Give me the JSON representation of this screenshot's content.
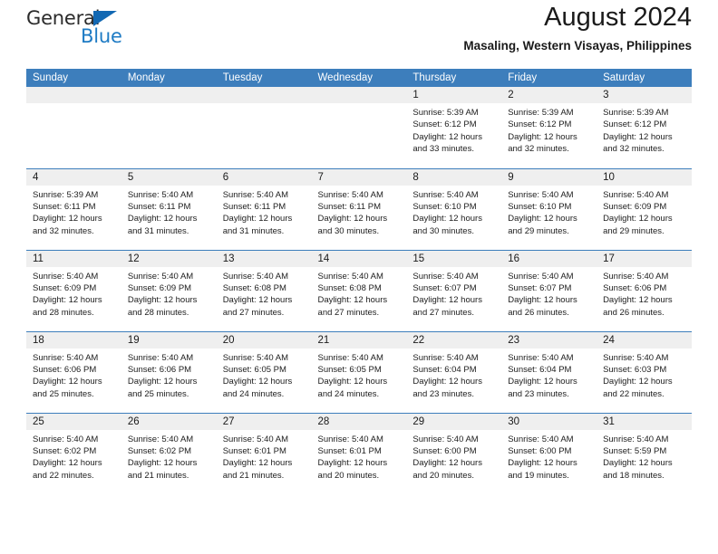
{
  "brand": {
    "name_part1": "General",
    "name_part2": "Blue",
    "triangle_color": "#1268b3",
    "blue_text_color": "#1e7bc4"
  },
  "header": {
    "title": "August 2024",
    "subtitle": "Masaling, Western Visayas, Philippines"
  },
  "theme": {
    "header_blue": "#3d7ebc",
    "daynum_gray": "#efefef",
    "cell_white": "#ffffff",
    "text_dark": "#1a1a1a"
  },
  "calendar": {
    "weekday_headers": [
      "Sunday",
      "Monday",
      "Tuesday",
      "Wednesday",
      "Thursday",
      "Friday",
      "Saturday"
    ],
    "labels": {
      "sunrise": "Sunrise:",
      "sunset": "Sunset:",
      "daylight": "Daylight:"
    },
    "weeks": [
      [
        {
          "day": "",
          "blank": true
        },
        {
          "day": "",
          "blank": true
        },
        {
          "day": "",
          "blank": true
        },
        {
          "day": "",
          "blank": true
        },
        {
          "day": "1",
          "sunrise": "Sunrise: 5:39 AM",
          "sunset": "Sunset: 6:12 PM",
          "daylight_line1": "Daylight: 12 hours",
          "daylight_line2": "and 33 minutes."
        },
        {
          "day": "2",
          "sunrise": "Sunrise: 5:39 AM",
          "sunset": "Sunset: 6:12 PM",
          "daylight_line1": "Daylight: 12 hours",
          "daylight_line2": "and 32 minutes."
        },
        {
          "day": "3",
          "sunrise": "Sunrise: 5:39 AM",
          "sunset": "Sunset: 6:12 PM",
          "daylight_line1": "Daylight: 12 hours",
          "daylight_line2": "and 32 minutes."
        }
      ],
      [
        {
          "day": "4",
          "sunrise": "Sunrise: 5:39 AM",
          "sunset": "Sunset: 6:11 PM",
          "daylight_line1": "Daylight: 12 hours",
          "daylight_line2": "and 32 minutes."
        },
        {
          "day": "5",
          "sunrise": "Sunrise: 5:40 AM",
          "sunset": "Sunset: 6:11 PM",
          "daylight_line1": "Daylight: 12 hours",
          "daylight_line2": "and 31 minutes."
        },
        {
          "day": "6",
          "sunrise": "Sunrise: 5:40 AM",
          "sunset": "Sunset: 6:11 PM",
          "daylight_line1": "Daylight: 12 hours",
          "daylight_line2": "and 31 minutes."
        },
        {
          "day": "7",
          "sunrise": "Sunrise: 5:40 AM",
          "sunset": "Sunset: 6:11 PM",
          "daylight_line1": "Daylight: 12 hours",
          "daylight_line2": "and 30 minutes."
        },
        {
          "day": "8",
          "sunrise": "Sunrise: 5:40 AM",
          "sunset": "Sunset: 6:10 PM",
          "daylight_line1": "Daylight: 12 hours",
          "daylight_line2": "and 30 minutes."
        },
        {
          "day": "9",
          "sunrise": "Sunrise: 5:40 AM",
          "sunset": "Sunset: 6:10 PM",
          "daylight_line1": "Daylight: 12 hours",
          "daylight_line2": "and 29 minutes."
        },
        {
          "day": "10",
          "sunrise": "Sunrise: 5:40 AM",
          "sunset": "Sunset: 6:09 PM",
          "daylight_line1": "Daylight: 12 hours",
          "daylight_line2": "and 29 minutes."
        }
      ],
      [
        {
          "day": "11",
          "sunrise": "Sunrise: 5:40 AM",
          "sunset": "Sunset: 6:09 PM",
          "daylight_line1": "Daylight: 12 hours",
          "daylight_line2": "and 28 minutes."
        },
        {
          "day": "12",
          "sunrise": "Sunrise: 5:40 AM",
          "sunset": "Sunset: 6:09 PM",
          "daylight_line1": "Daylight: 12 hours",
          "daylight_line2": "and 28 minutes."
        },
        {
          "day": "13",
          "sunrise": "Sunrise: 5:40 AM",
          "sunset": "Sunset: 6:08 PM",
          "daylight_line1": "Daylight: 12 hours",
          "daylight_line2": "and 27 minutes."
        },
        {
          "day": "14",
          "sunrise": "Sunrise: 5:40 AM",
          "sunset": "Sunset: 6:08 PM",
          "daylight_line1": "Daylight: 12 hours",
          "daylight_line2": "and 27 minutes."
        },
        {
          "day": "15",
          "sunrise": "Sunrise: 5:40 AM",
          "sunset": "Sunset: 6:07 PM",
          "daylight_line1": "Daylight: 12 hours",
          "daylight_line2": "and 27 minutes."
        },
        {
          "day": "16",
          "sunrise": "Sunrise: 5:40 AM",
          "sunset": "Sunset: 6:07 PM",
          "daylight_line1": "Daylight: 12 hours",
          "daylight_line2": "and 26 minutes."
        },
        {
          "day": "17",
          "sunrise": "Sunrise: 5:40 AM",
          "sunset": "Sunset: 6:06 PM",
          "daylight_line1": "Daylight: 12 hours",
          "daylight_line2": "and 26 minutes."
        }
      ],
      [
        {
          "day": "18",
          "sunrise": "Sunrise: 5:40 AM",
          "sunset": "Sunset: 6:06 PM",
          "daylight_line1": "Daylight: 12 hours",
          "daylight_line2": "and 25 minutes."
        },
        {
          "day": "19",
          "sunrise": "Sunrise: 5:40 AM",
          "sunset": "Sunset: 6:06 PM",
          "daylight_line1": "Daylight: 12 hours",
          "daylight_line2": "and 25 minutes."
        },
        {
          "day": "20",
          "sunrise": "Sunrise: 5:40 AM",
          "sunset": "Sunset: 6:05 PM",
          "daylight_line1": "Daylight: 12 hours",
          "daylight_line2": "and 24 minutes."
        },
        {
          "day": "21",
          "sunrise": "Sunrise: 5:40 AM",
          "sunset": "Sunset: 6:05 PM",
          "daylight_line1": "Daylight: 12 hours",
          "daylight_line2": "and 24 minutes."
        },
        {
          "day": "22",
          "sunrise": "Sunrise: 5:40 AM",
          "sunset": "Sunset: 6:04 PM",
          "daylight_line1": "Daylight: 12 hours",
          "daylight_line2": "and 23 minutes."
        },
        {
          "day": "23",
          "sunrise": "Sunrise: 5:40 AM",
          "sunset": "Sunset: 6:04 PM",
          "daylight_line1": "Daylight: 12 hours",
          "daylight_line2": "and 23 minutes."
        },
        {
          "day": "24",
          "sunrise": "Sunrise: 5:40 AM",
          "sunset": "Sunset: 6:03 PM",
          "daylight_line1": "Daylight: 12 hours",
          "daylight_line2": "and 22 minutes."
        }
      ],
      [
        {
          "day": "25",
          "sunrise": "Sunrise: 5:40 AM",
          "sunset": "Sunset: 6:02 PM",
          "daylight_line1": "Daylight: 12 hours",
          "daylight_line2": "and 22 minutes."
        },
        {
          "day": "26",
          "sunrise": "Sunrise: 5:40 AM",
          "sunset": "Sunset: 6:02 PM",
          "daylight_line1": "Daylight: 12 hours",
          "daylight_line2": "and 21 minutes."
        },
        {
          "day": "27",
          "sunrise": "Sunrise: 5:40 AM",
          "sunset": "Sunset: 6:01 PM",
          "daylight_line1": "Daylight: 12 hours",
          "daylight_line2": "and 21 minutes."
        },
        {
          "day": "28",
          "sunrise": "Sunrise: 5:40 AM",
          "sunset": "Sunset: 6:01 PM",
          "daylight_line1": "Daylight: 12 hours",
          "daylight_line2": "and 20 minutes."
        },
        {
          "day": "29",
          "sunrise": "Sunrise: 5:40 AM",
          "sunset": "Sunset: 6:00 PM",
          "daylight_line1": "Daylight: 12 hours",
          "daylight_line2": "and 20 minutes."
        },
        {
          "day": "30",
          "sunrise": "Sunrise: 5:40 AM",
          "sunset": "Sunset: 6:00 PM",
          "daylight_line1": "Daylight: 12 hours",
          "daylight_line2": "and 19 minutes."
        },
        {
          "day": "31",
          "sunrise": "Sunrise: 5:40 AM",
          "sunset": "Sunset: 5:59 PM",
          "daylight_line1": "Daylight: 12 hours",
          "daylight_line2": "and 18 minutes."
        }
      ]
    ]
  }
}
